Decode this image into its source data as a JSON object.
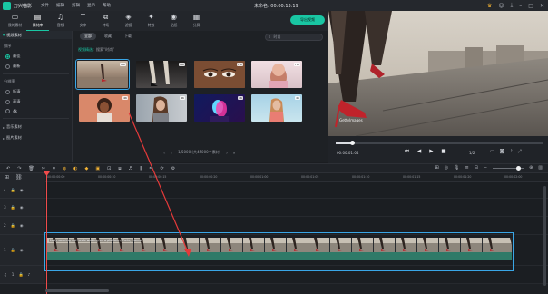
{
  "app": {
    "name": "万兴喵影",
    "window_title": "未命名: 00:00:13:19"
  },
  "menu": [
    "文件",
    "编辑",
    "剪辑",
    "显示",
    "帮助"
  ],
  "toolbar": {
    "items": [
      {
        "label": "我的素材",
        "icon": "folder-icon"
      },
      {
        "label": "素材库",
        "icon": "library-icon",
        "active": true
      },
      {
        "label": "音频",
        "icon": "music-icon"
      },
      {
        "label": "文字",
        "icon": "text-icon"
      },
      {
        "label": "转场",
        "icon": "transition-icon"
      },
      {
        "label": "滤镜",
        "icon": "filter-icon"
      },
      {
        "label": "特效",
        "icon": "effects-icon"
      },
      {
        "label": "贴纸",
        "icon": "sticker-icon"
      },
      {
        "label": "分屏",
        "icon": "splitscreen-icon"
      }
    ],
    "export_label": "导出视频"
  },
  "sidebar": {
    "header": "视频素材",
    "sections": [
      {
        "title": "排序",
        "options": [
          {
            "label": "最佳",
            "selected": true
          },
          {
            "label": "最新",
            "selected": false
          }
        ]
      },
      {
        "title": "分辨率",
        "options": [
          {
            "label": "标清",
            "selected": false
          },
          {
            "label": "高清",
            "selected": false
          },
          {
            "label": "4k",
            "selected": false
          }
        ]
      }
    ],
    "groups": [
      "音乐素材",
      "图片素材"
    ]
  },
  "browser": {
    "tabs": [
      {
        "label": "全部",
        "active": true
      },
      {
        "label": "收藏",
        "active": false
      },
      {
        "label": "下载",
        "active": false
      }
    ],
    "search_value": "时尚",
    "breadcrumb_prefix": "视频精选：",
    "breadcrumb_result": "搜索“时尚”",
    "thumbnails": [
      {
        "badge": "HD",
        "selected": true
      },
      {
        "badge": "HD"
      },
      {
        "badge": "HD"
      },
      {
        "badge": "HD"
      },
      {
        "badge": "4K"
      },
      {
        "badge": "4K"
      },
      {
        "badge": "4K"
      },
      {
        "badge": "4K"
      }
    ],
    "pagination": "1/5000 (共45000个素材)"
  },
  "preview": {
    "watermark": "GettyImages",
    "timecode": "00:00:01:04",
    "ratio": "1/2",
    "progress": 0.08
  },
  "timeline": {
    "ruler_ticks": [
      "00:00:00:00",
      "00:00:00:10",
      "00:00:00:15",
      "00:00:00:20",
      "00:00:01:00",
      "00:00:01:05",
      "00:00:01:10",
      "00:00:01:15",
      "00:00:01:20",
      "00:00:02:00"
    ],
    "tracks": [
      {
        "label": "4"
      },
      {
        "label": "3"
      },
      {
        "label": "2"
      },
      {
        "label": "1"
      },
      {
        "label": "1"
      }
    ],
    "clip_label": "Lady wearing red heels walking on a platform, Paris, France"
  },
  "colors": {
    "accent": "#19c6a3",
    "selection": "#3aa6e6",
    "playhead": "#ef4b4b"
  }
}
